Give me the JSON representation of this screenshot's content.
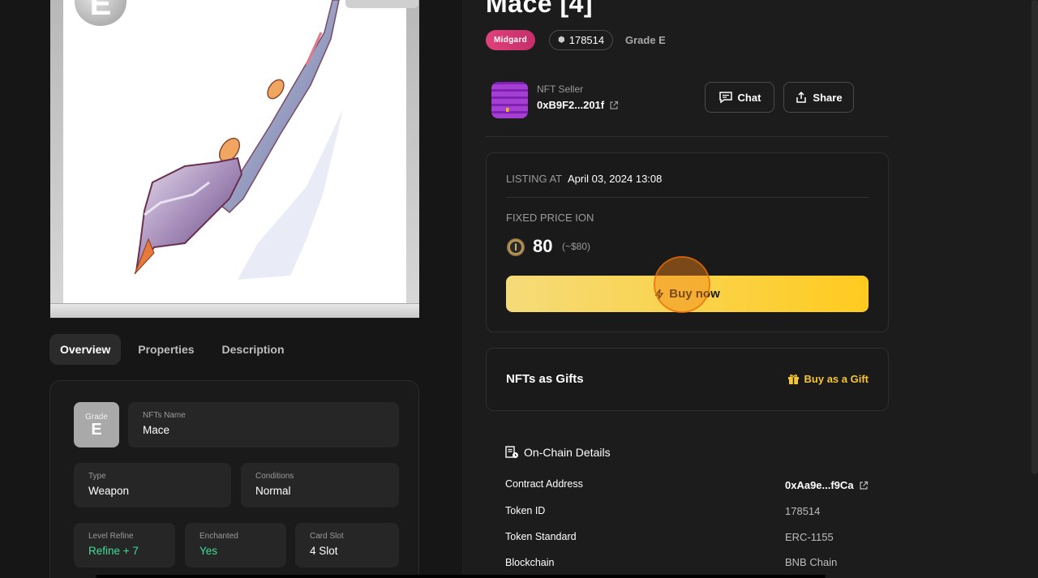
{
  "nft": {
    "title": "Mace [4]",
    "realm": "Midgard",
    "token_badge": "178514",
    "grade_text": "Grade E",
    "card_grade": "E"
  },
  "seller": {
    "label": "NFT Seller",
    "address": "0xB9F2...201f"
  },
  "actions": {
    "chat_label": "Chat",
    "share_label": "Share"
  },
  "listing": {
    "listing_at_label": "LISTING AT",
    "listing_date": "April 03, 2024 13:08",
    "fixed_price_label": "FIXED PRICE ION",
    "price": "80",
    "price_usd": "(~$80)",
    "buy_label": "Buy now"
  },
  "gifts": {
    "title": "NFTs as Gifts",
    "link_label": "Buy as a Gift"
  },
  "tabs": [
    {
      "label": "Overview"
    },
    {
      "label": "Properties"
    },
    {
      "label": "Description"
    }
  ],
  "overview": {
    "grade_label": "Grade",
    "grade_value": "E",
    "name_label": "NFTs Name",
    "name_value": "Mace",
    "type_label": "Type",
    "type_value": "Weapon",
    "conditions_label": "Conditions",
    "conditions_value": "Normal",
    "level_label": "Level Refine",
    "level_value": "Refine + 7",
    "enchanted_label": "Enchanted",
    "enchanted_value": "Yes",
    "slot_label": "Card Slot",
    "slot_value": "4 Slot"
  },
  "onchain": {
    "title": "On-Chain Details",
    "rows": [
      {
        "label": "Contract Address",
        "value": "0xAa9e...f9Ca"
      },
      {
        "label": "Token ID",
        "value": "178514"
      },
      {
        "label": "Token Standard",
        "value": "ERC-1155"
      },
      {
        "label": "Blockchain",
        "value": "BNB Chain"
      }
    ]
  },
  "colors": {
    "accent_yellow": "#ffcb1f",
    "realm_pink": "#e0417a",
    "green_value": "#3fdc9a"
  }
}
